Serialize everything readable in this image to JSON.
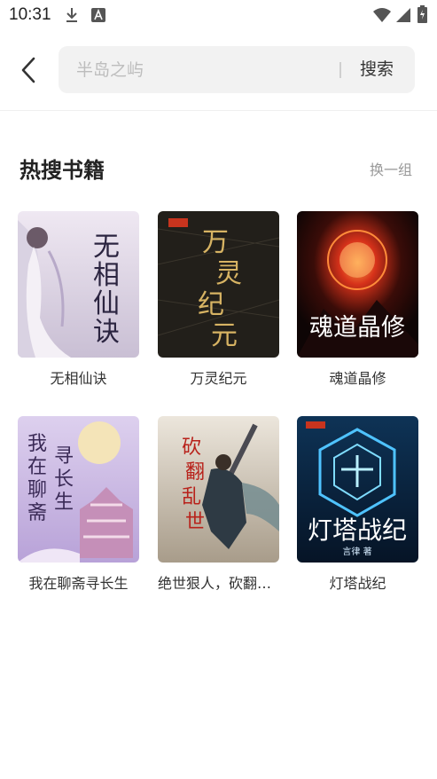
{
  "status_bar": {
    "time": "10:31"
  },
  "search": {
    "placeholder": "半岛之屿",
    "button_label": "搜索"
  },
  "section": {
    "title": "热搜书籍",
    "refresh_label": "换一组"
  },
  "books": [
    {
      "title": "无相仙诀",
      "cover_text": "无相仙诀",
      "cover_colors": [
        "#efe8f2",
        "#c9bfd4"
      ]
    },
    {
      "title": "万灵纪元",
      "cover_text": "万灵纪元",
      "cover_colors": [
        "#2a2620",
        "#1a1813"
      ]
    },
    {
      "title": "魂道晶修",
      "cover_text": "魂道晶修",
      "cover_colors": [
        "#3a0c08",
        "#120606"
      ]
    },
    {
      "title": "我在聊斋寻长生",
      "cover_text": "我在聊斋寻长生",
      "cover_colors": [
        "#d8c8ea",
        "#b8a2d8"
      ]
    },
    {
      "title": "绝世狠人，砍翻乱世",
      "cover_text": "砍翻乱世",
      "cover_colors": [
        "#e9e2d6",
        "#b7ab99"
      ]
    },
    {
      "title": "灯塔战纪",
      "cover_text": "灯塔战纪",
      "cover_sub": "言律 著",
      "cover_colors": [
        "#0c2a4a",
        "#06162a"
      ]
    }
  ]
}
